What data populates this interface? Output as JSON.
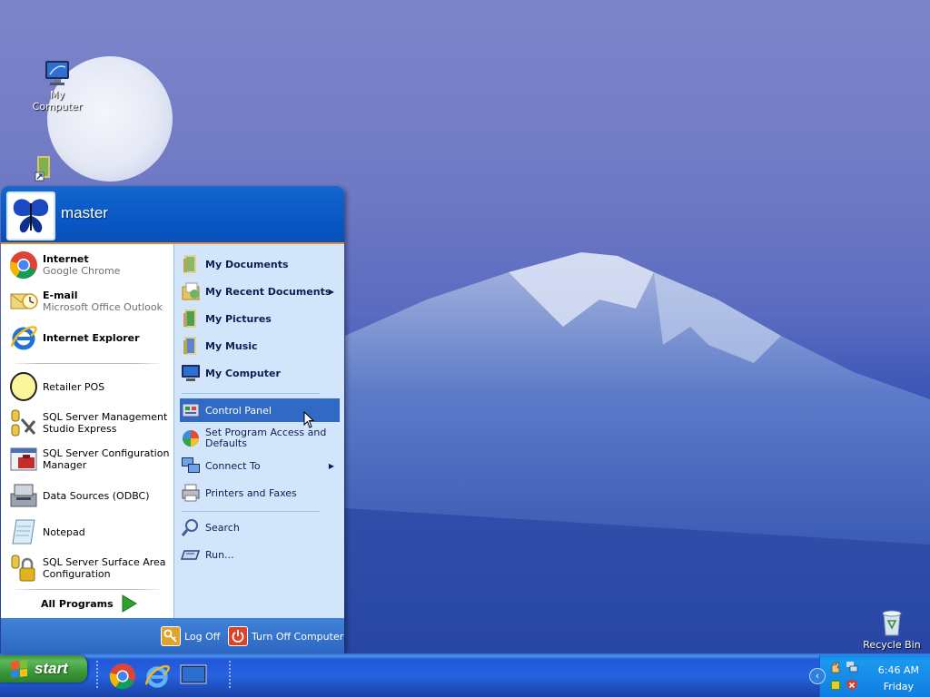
{
  "desktop": {
    "icons": [
      {
        "label": "My Computer",
        "icon": "my-computer-icon"
      },
      {
        "label": "",
        "icon": "shortcut-folder-icon"
      },
      {
        "label": "Recycle Bin",
        "icon": "recycle-bin-icon"
      }
    ]
  },
  "start_menu": {
    "user_name": "master",
    "pinned": [
      {
        "title": "Internet",
        "subtitle": "Google Chrome",
        "icon": "chrome-icon"
      },
      {
        "title": "E-mail",
        "subtitle": "Microsoft Office Outlook",
        "icon": "outlook-icon"
      },
      {
        "title": "Internet Explorer",
        "subtitle": "",
        "icon": "ie-icon"
      }
    ],
    "recent": [
      {
        "label": "Retailer POS",
        "icon": "retailer-pos-icon"
      },
      {
        "label": "SQL Server Management Studio Express",
        "icon": "sql-mgmt-icon"
      },
      {
        "label": "SQL Server Configuration Manager",
        "icon": "sql-config-icon"
      },
      {
        "label": "Data Sources (ODBC)",
        "icon": "odbc-icon"
      },
      {
        "label": "Notepad",
        "icon": "notepad-icon"
      },
      {
        "label": "SQL Server Surface Area Configuration",
        "icon": "sql-surface-icon"
      }
    ],
    "all_programs": "All Programs",
    "places": [
      {
        "label": "My Documents",
        "icon": "my-documents-icon"
      },
      {
        "label": "My Recent Documents",
        "icon": "recent-documents-icon",
        "submenu": true
      },
      {
        "label": "My Pictures",
        "icon": "my-pictures-icon"
      },
      {
        "label": "My Music",
        "icon": "my-music-icon"
      },
      {
        "label": "My Computer",
        "icon": "my-computer-icon"
      }
    ],
    "system": [
      {
        "label": "Control Panel",
        "icon": "control-panel-icon",
        "highlighted": true
      },
      {
        "label": "Set Program Access and Defaults",
        "icon": "program-access-icon"
      },
      {
        "label": "Connect To",
        "icon": "connect-to-icon",
        "submenu": true
      },
      {
        "label": "Printers and Faxes",
        "icon": "printer-icon"
      }
    ],
    "tools": [
      {
        "label": "Search",
        "icon": "search-icon"
      },
      {
        "label": "Run...",
        "icon": "run-icon"
      }
    ],
    "footer": {
      "log_off": "Log Off",
      "turn_off": "Turn Off Computer"
    }
  },
  "taskbar": {
    "start_label": "start",
    "quick_launch": [
      "chrome-icon",
      "ie-icon",
      "show-desktop-icon"
    ],
    "clock": {
      "time": "6:46 AM",
      "day": "Friday"
    }
  },
  "colors": {
    "taskbar_blue": "#245edb",
    "start_green": "#3b9a38",
    "highlight": "#316ac5",
    "right_pane": "#d3e5fa"
  }
}
